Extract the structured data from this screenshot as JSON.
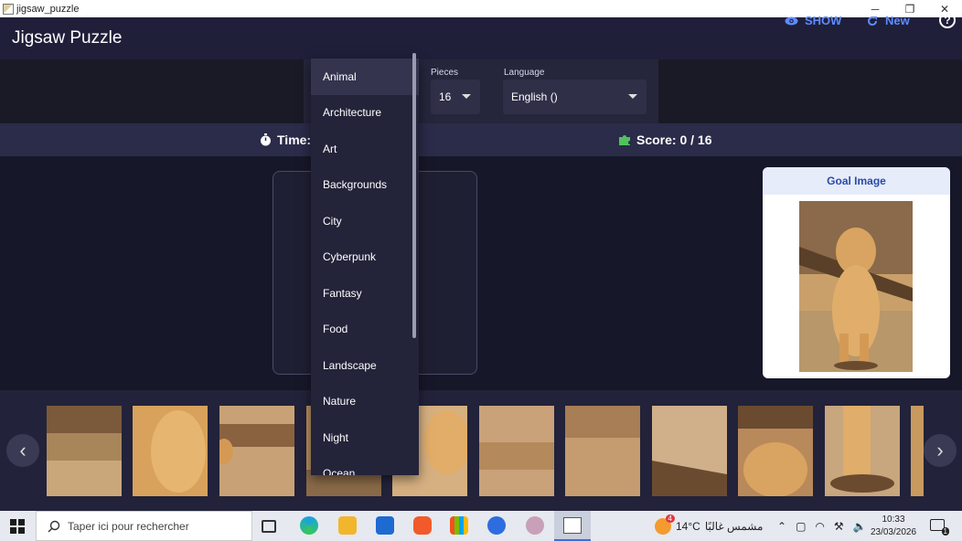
{
  "window": {
    "title": "jigsaw_puzzle"
  },
  "appbar": {
    "title": "Jigsaw Puzzle",
    "show_label": "SHOW",
    "new_label": "New",
    "help_label": "?"
  },
  "options": {
    "pieces_label": "Pieces",
    "pieces_value": "16",
    "language_label": "Language",
    "language_value": "English ()"
  },
  "status": {
    "time_label": "Time:",
    "score_label": "Score: 0 / 16"
  },
  "goal": {
    "title": "Goal Image"
  },
  "category_dropdown": {
    "items": [
      "Animal",
      "Architecture",
      "Art",
      "Backgrounds",
      "City",
      "Cyberpunk",
      "Fantasy",
      "Food",
      "Landscape",
      "Nature",
      "Night",
      "Ocean"
    ],
    "selected": "Animal"
  },
  "taskbar": {
    "search_placeholder": "Taper ici pour rechercher",
    "weather_temp": "14°C",
    "weather_text": "مشمس غالبًا",
    "weather_badge": "4",
    "time": "10:33",
    "date": "23/03/2026",
    "notif_count": "1"
  },
  "colors": {
    "accent": "#5f8cff",
    "appbar": "#1f1f3a",
    "status": "#2b2b4a"
  }
}
